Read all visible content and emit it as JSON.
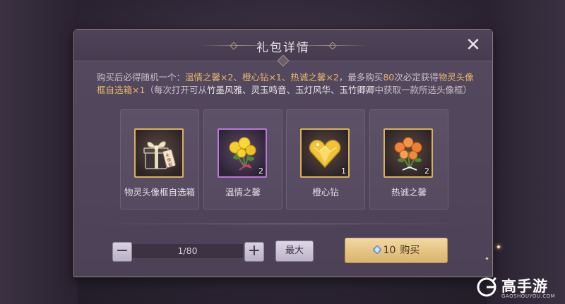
{
  "dialog": {
    "title": "礼包详情",
    "close_glyph": "✕"
  },
  "description": {
    "p1": "购买后必得随机一个：",
    "p2": "温情之馨×2、橙心钻×1、热诚之馨×2",
    "p3": "，最多购买",
    "p4": "80",
    "p5": "次必定获得",
    "p6": "物灵头像框自选箱×1",
    "p7": "（每次打开可从",
    "p8": "竹墨风雅、灵玉鸣音、玉灯风华、玉竹卿卿",
    "p9": "中获取一款所选头像框）"
  },
  "items": [
    {
      "name": "物灵头像框自选箱",
      "qty": "",
      "icon": "gift-box-icon",
      "frame": "gold"
    },
    {
      "name": "温情之馨",
      "qty": "2",
      "icon": "yellow-rose-bouquet-icon",
      "frame": "purple"
    },
    {
      "name": "橙心钻",
      "qty": "1",
      "icon": "heart-diamond-icon",
      "frame": "gold"
    },
    {
      "name": "热诚之馨",
      "qty": "2",
      "icon": "orange-rose-bouquet-icon",
      "frame": "gold"
    }
  ],
  "purchase": {
    "minus": "−",
    "plus": "+",
    "quantity": "1/80",
    "max_label": "最大",
    "price": "10",
    "buy_label": "购买"
  },
  "watermark": {
    "brand": "高手游",
    "url": "GAOSHOUYOU.COM"
  },
  "colors": {
    "accent_gold": "#e8b76c",
    "buy_button": "#e6c483"
  }
}
